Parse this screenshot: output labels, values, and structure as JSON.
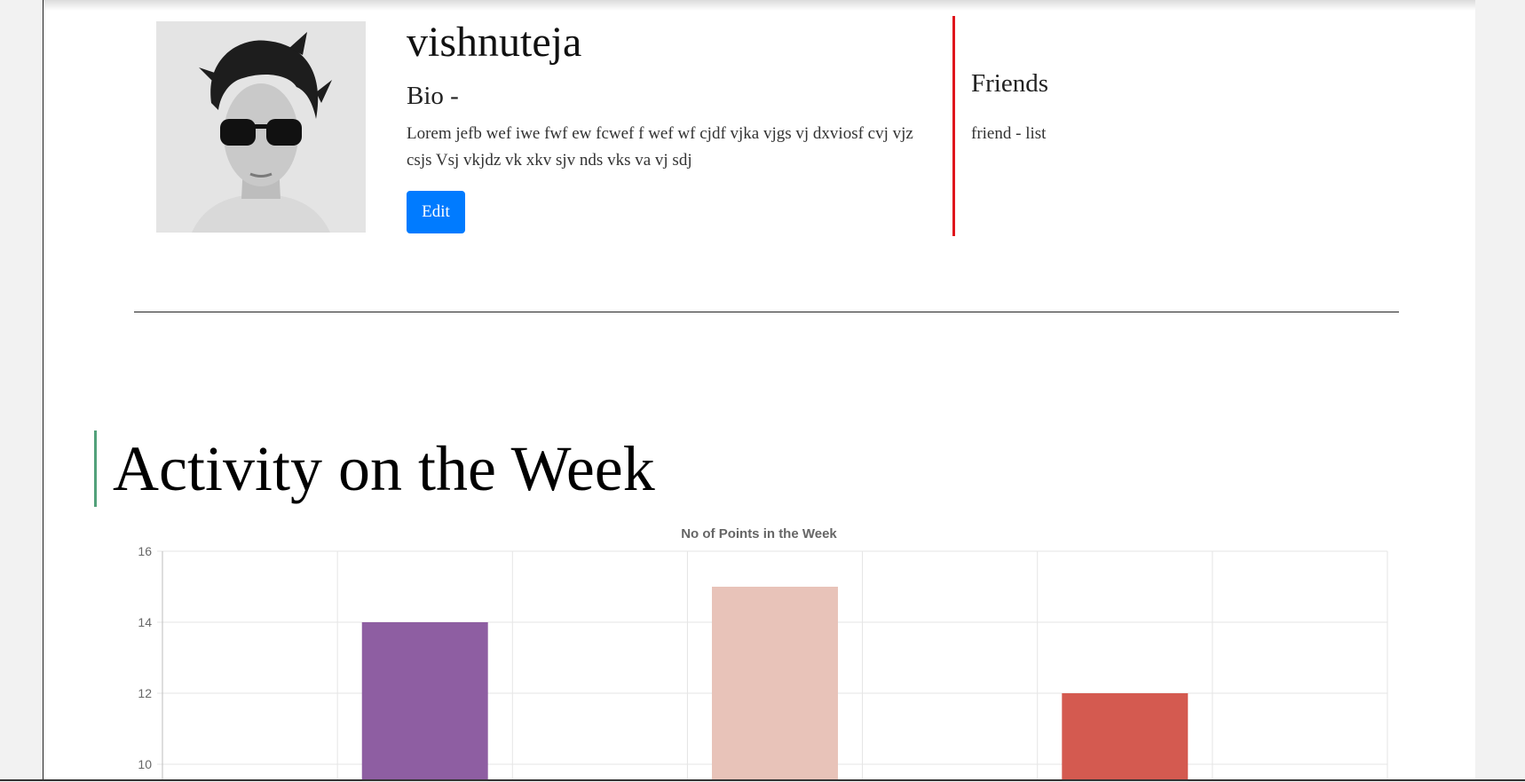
{
  "profile": {
    "username": "vishnuteja",
    "bio_label": "Bio -",
    "bio_text": "Lorem jefb wef iwe fwf ew fcwef f wef wf cjdf vjka vjgs vj dxviosf cvj vjz csjs Vsj vkjdz vk xkv sjv nds vks va vj sdj",
    "edit_label": "Edit"
  },
  "friends": {
    "title": "Friends",
    "list_text": "friend - list"
  },
  "activity": {
    "section_title": "Activity on the Week"
  },
  "colors": {
    "edit_button": "#007bff",
    "friends_border": "#e0161c",
    "section_accent": "#52a17a"
  },
  "chart_data": {
    "type": "bar",
    "title": "No of Points in the Week",
    "xlabel": "",
    "ylabel": "",
    "ylim": [
      10,
      16
    ],
    "yticks": [
      10,
      12,
      14,
      16
    ],
    "grid": true,
    "categories": [
      "",
      "",
      "",
      "",
      "",
      "",
      ""
    ],
    "values": [
      null,
      14,
      null,
      15,
      null,
      12,
      null
    ],
    "bar_colors": [
      "#8e5ea2",
      "#8e5ea2",
      "#e8c3b9",
      "#e8c3b9",
      "#c45850",
      "#d45a50",
      "#c45850"
    ]
  }
}
